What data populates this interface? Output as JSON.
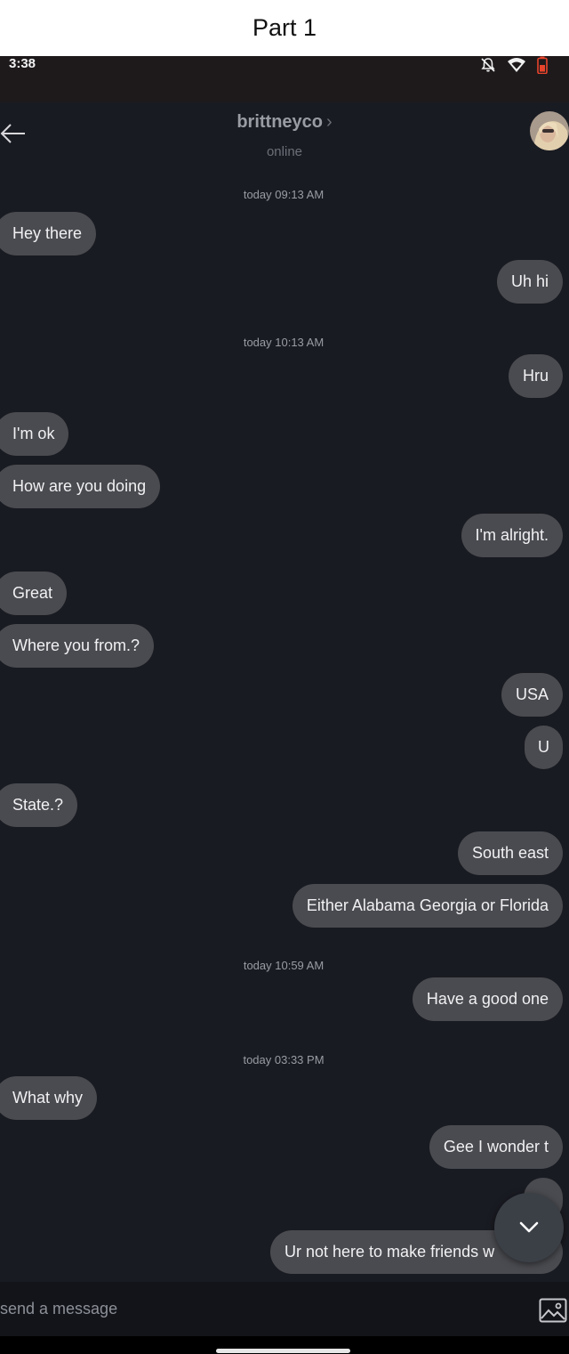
{
  "caption": "Part 1",
  "status": {
    "time": "3:38"
  },
  "header": {
    "name": "brittneyco",
    "chevron": "›",
    "presence": "online"
  },
  "timestamps": [
    "today 09:13 AM",
    "today 10:13 AM",
    "today 10:59 AM",
    "today 03:33 PM"
  ],
  "messages": [
    "Hey there",
    "Uh hi",
    "Hru",
    "I'm ok",
    "How are you doing",
    "I'm alright.",
    "Great",
    "Where you from.?",
    "USA",
    "U",
    "State.?",
    "South east",
    "Either Alabama Georgia or Florida",
    "Have a good one",
    "What why",
    "Gee I wonder t",
    "Ur not here to make friends w"
  ],
  "composer": {
    "placeholder": "send a message"
  },
  "colors": {
    "background": "#191b22",
    "bubble": "#4a4b50",
    "caption_bg": "#ffffff",
    "battery": "#e8442c"
  }
}
